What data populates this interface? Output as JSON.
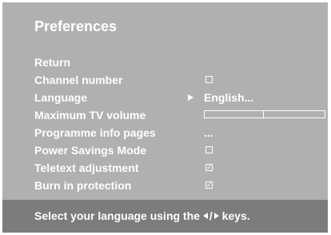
{
  "title": "Preferences",
  "menu": {
    "items": [
      {
        "label": "Return"
      },
      {
        "label": "Channel number",
        "control": "checkbox",
        "checked": false
      },
      {
        "label": "Language",
        "control": "submenu",
        "value": "English..."
      },
      {
        "label": "Maximum TV volume",
        "control": "slider",
        "level": 0.49
      },
      {
        "label": "Programme info pages",
        "control": "submenu",
        "value": "..."
      },
      {
        "label": "Power Savings Mode",
        "control": "checkbox",
        "checked": false
      },
      {
        "label": "Teletext adjustment",
        "control": "checkbox",
        "checked": true
      },
      {
        "label": "Burn in protection",
        "control": "checkbox",
        "checked": true
      }
    ]
  },
  "footer": {
    "text_before": "Select your language using the",
    "key_separator": "/",
    "text_after": "keys."
  },
  "colors": {
    "menu_background": "#b0b0b0",
    "footer_background": "#7c7c7c",
    "text": "#ffffff"
  }
}
